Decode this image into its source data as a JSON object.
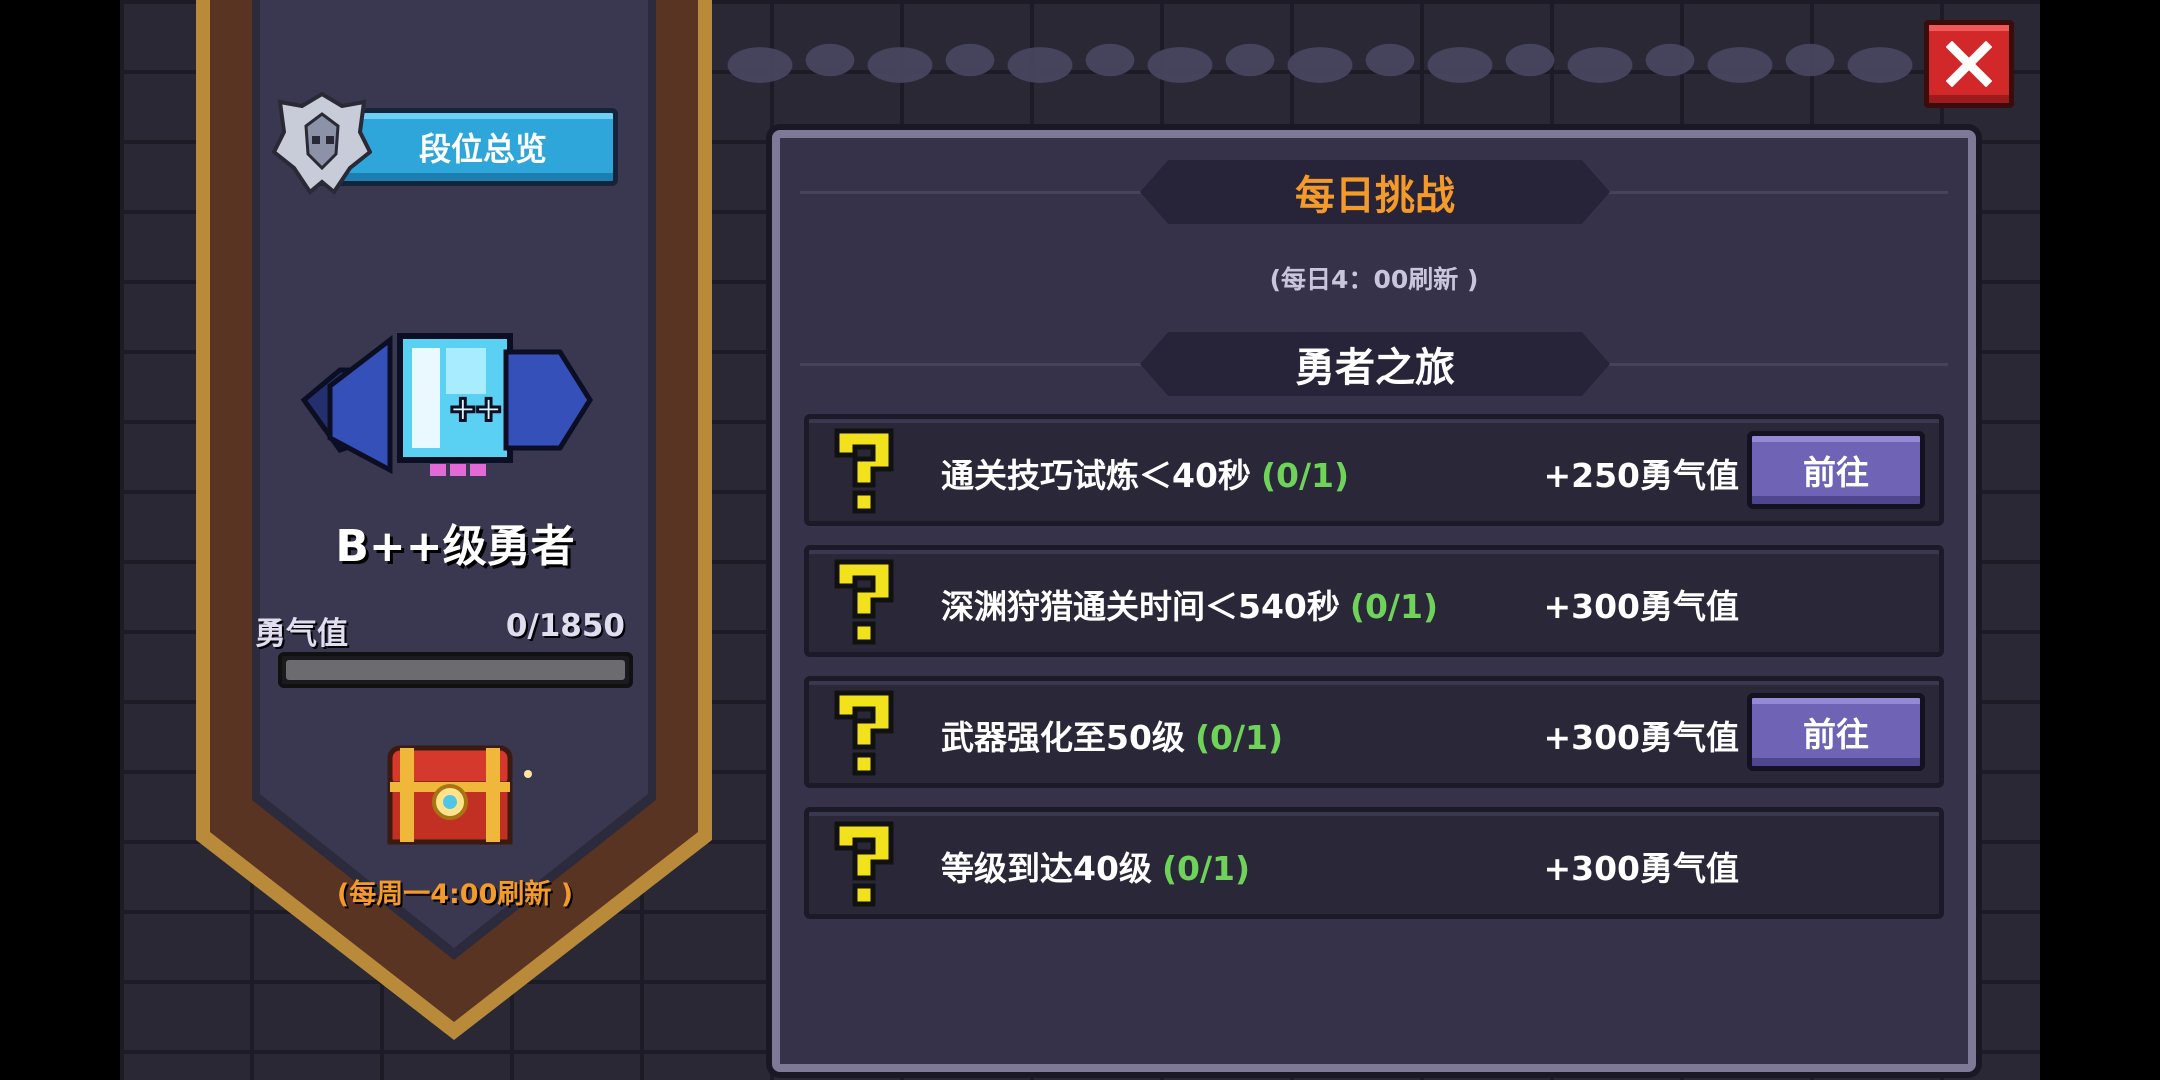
{
  "left_panel": {
    "rank_overview_label": "段位总览",
    "rank_title": "B++级勇者",
    "courage_label": "勇气值",
    "courage_value": "0/1850",
    "courage_progress": 0,
    "weekly_refresh": "(每周一4:00刷新 )"
  },
  "daily": {
    "title": "每日挑战",
    "refresh_note": "(每日4：00刷新 )",
    "section_title": "勇者之旅",
    "tasks": [
      {
        "desc": "通关技巧试炼＜40秒",
        "progress": "(0/1)",
        "reward": "+250勇气值",
        "button": "前往"
      },
      {
        "desc": "深渊狩猎通关时间＜540秒",
        "progress": "(0/1)",
        "reward": "+300勇气值",
        "button": ""
      },
      {
        "desc": "武器强化至50级",
        "progress": "(0/1)",
        "reward": "+300勇气值",
        "button": "前往"
      },
      {
        "desc": "等级到达40级",
        "progress": "(0/1)",
        "reward": "+300勇气值",
        "button": ""
      }
    ]
  },
  "colors": {
    "accent_orange": "#f39a2a",
    "progress_green": "#6fd35a",
    "close_red": "#d3282a",
    "button_purple": "#6e63b4"
  },
  "icons": [
    "rank-emblem-icon",
    "close-icon",
    "question-mark-icon",
    "treasure-chest-icon",
    "rank-badge-icon"
  ]
}
